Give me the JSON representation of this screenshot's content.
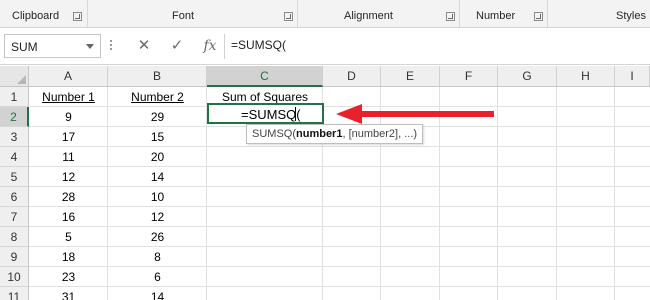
{
  "ribbon": {
    "groups": [
      {
        "label": "Clipboard"
      },
      {
        "label": "Font"
      },
      {
        "label": "Alignment"
      },
      {
        "label": "Number"
      },
      {
        "label": "Styles"
      }
    ]
  },
  "formula_bar": {
    "name_box": "SUM",
    "cancel_icon": "✕",
    "enter_icon": "✓",
    "fx_label": "fx",
    "formula": "=SUMSQ("
  },
  "sheet": {
    "columns": [
      "A",
      "B",
      "C",
      "D",
      "E",
      "F",
      "G",
      "H",
      "I"
    ],
    "rows": [
      "1",
      "2",
      "3",
      "4",
      "5",
      "6",
      "7",
      "8",
      "9",
      "10",
      "11"
    ],
    "active_column": "C",
    "active_row": "2",
    "header_row": {
      "a": "Number 1",
      "b": "Number 2",
      "c": "Sum of Squares"
    },
    "data": [
      {
        "a": "9",
        "b": "29"
      },
      {
        "a": "17",
        "b": "15"
      },
      {
        "a": "11",
        "b": "20"
      },
      {
        "a": "12",
        "b": "14"
      },
      {
        "a": "28",
        "b": "10"
      },
      {
        "a": "16",
        "b": "12"
      },
      {
        "a": "5",
        "b": "26"
      },
      {
        "a": "18",
        "b": "8"
      },
      {
        "a": "23",
        "b": "6"
      },
      {
        "a": "31",
        "b": "14"
      }
    ],
    "editing_text": "=SUMSQ("
  },
  "tooltip": {
    "func": "SUMSQ(",
    "arg1": "number1",
    "rest": ", [number2], ...)"
  },
  "colors": {
    "accent_green": "#217346",
    "arrow_red": "#e8212b"
  }
}
